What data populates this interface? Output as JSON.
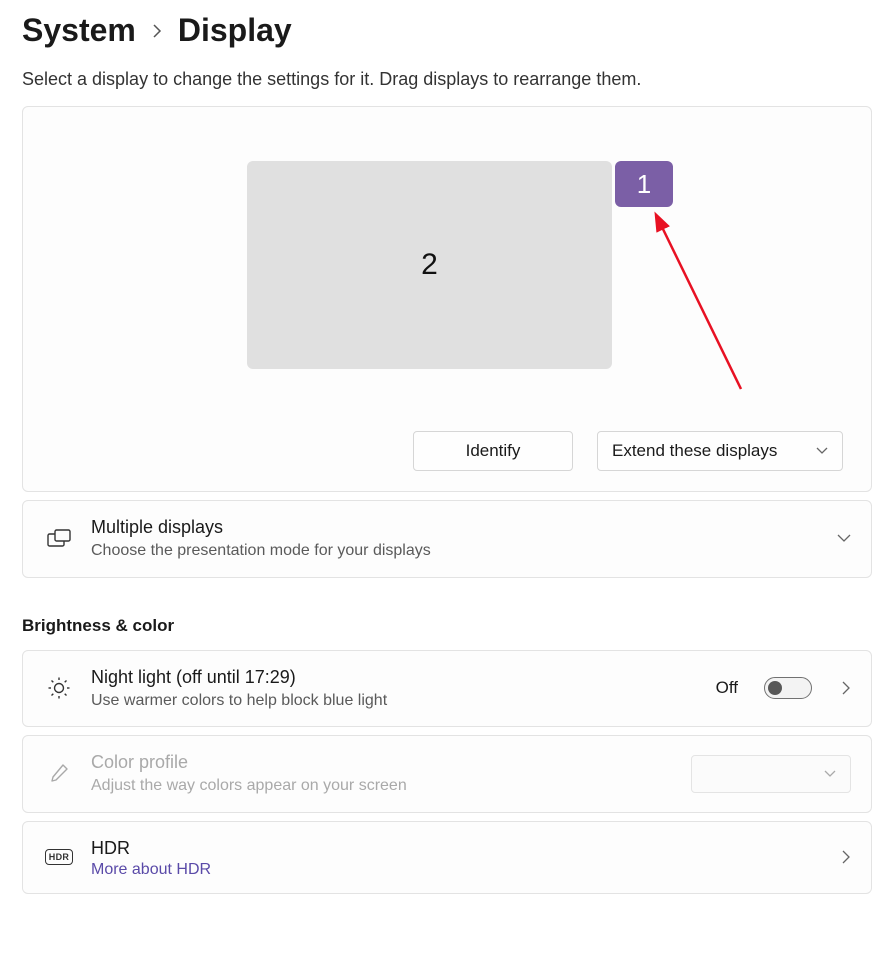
{
  "breadcrumb": {
    "parent": "System",
    "current": "Display"
  },
  "subtitle": "Select a display to change the settings for it. Drag displays to rearrange them.",
  "arrange": {
    "monitor1_label": "1",
    "monitor2_label": "2",
    "identify_label": "Identify",
    "mode_label": "Extend these displays"
  },
  "multiple_displays": {
    "title": "Multiple displays",
    "desc": "Choose the presentation mode for your displays"
  },
  "section_brightness": "Brightness & color",
  "night_light": {
    "title": "Night light (off until 17:29)",
    "desc": "Use warmer colors to help block blue light",
    "status": "Off"
  },
  "color_profile": {
    "title": "Color profile",
    "desc": "Adjust the way colors appear on your screen"
  },
  "hdr": {
    "title": "HDR",
    "link": "More about HDR"
  }
}
